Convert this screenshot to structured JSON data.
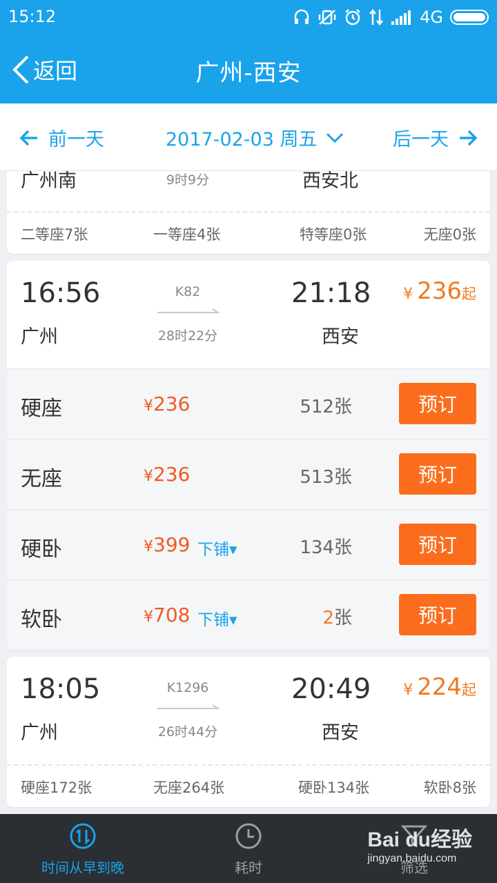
{
  "status": {
    "time": "15:12",
    "network": "4G"
  },
  "header": {
    "back_label": "返回",
    "title": "广州-西安"
  },
  "datebar": {
    "prev_label": "前一天",
    "date": "2017-02-03 周五",
    "next_label": "后一天"
  },
  "card0": {
    "dep_station": "广州南",
    "duration": "9时9分",
    "arr_station": "西安北",
    "seats": [
      "二等座7张",
      "一等座4张",
      "特等座0张",
      "无座0张"
    ]
  },
  "card1": {
    "dep_time": "16:56",
    "dep_station": "广州",
    "train_no": "K82",
    "duration": "28时22分",
    "arr_time": "21:18",
    "arr_station": "西安",
    "price_symbol": "¥",
    "price": "236",
    "price_suffix": "起",
    "rows": [
      {
        "name": "硬座",
        "yen": "¥",
        "price": "236",
        "berth": "",
        "count_num": "512",
        "count_unit": "张",
        "low": false,
        "book_label": "预订"
      },
      {
        "name": "无座",
        "yen": "¥",
        "price": "236",
        "berth": "",
        "count_num": "513",
        "count_unit": "张",
        "low": false,
        "book_label": "预订"
      },
      {
        "name": "硬卧",
        "yen": "¥",
        "price": "399",
        "berth": "下铺▾",
        "count_num": "134",
        "count_unit": "张",
        "low": false,
        "book_label": "预订"
      },
      {
        "name": "软卧",
        "yen": "¥",
        "price": "708",
        "berth": "下铺▾",
        "count_num": "2",
        "count_unit": "张",
        "low": true,
        "book_label": "预订"
      }
    ]
  },
  "card2": {
    "dep_time": "18:05",
    "dep_station": "广州",
    "train_no": "K1296",
    "duration": "26时44分",
    "arr_time": "20:49",
    "arr_station": "西安",
    "price_symbol": "¥",
    "price": "224",
    "price_suffix": "起",
    "seats": [
      "硬座172张",
      "无座264张",
      "硬卧134张",
      "软卧8张"
    ]
  },
  "tabs": [
    {
      "label": "时间从早到晚",
      "icon": "sort-icon",
      "active": true
    },
    {
      "label": "耗时",
      "icon": "clock-icon",
      "active": false
    },
    {
      "label": "筛选",
      "icon": "filter-icon",
      "active": false
    }
  ],
  "watermark": {
    "brand": "Bai du经验",
    "sub": "jingyan.baidu.com"
  },
  "colors": {
    "primary": "#1aa3ea",
    "price": "#f07a21",
    "seat_price": "#f05a22",
    "book": "#fb6d1c",
    "tabbar": "#2b2f33"
  }
}
